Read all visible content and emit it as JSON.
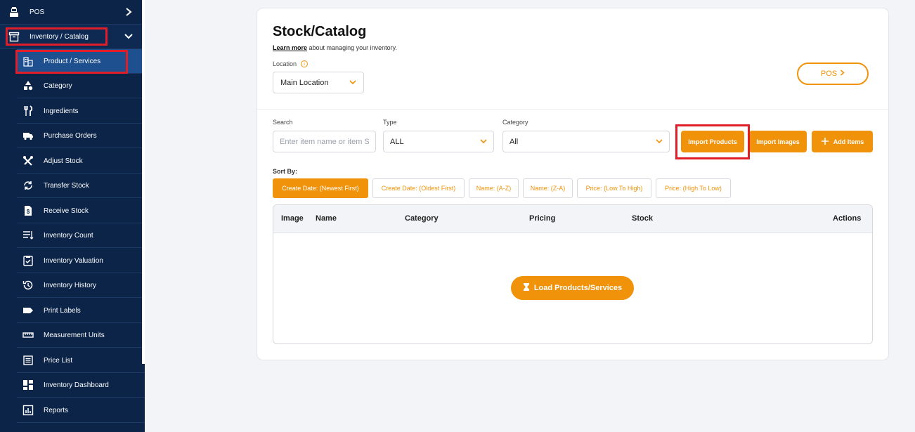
{
  "sidebar": {
    "pos": "POS",
    "inventory": "Inventory / Catalog",
    "items": [
      {
        "label": "Product / Services",
        "icon": "building-icon"
      },
      {
        "label": "Category",
        "icon": "shapes-icon"
      },
      {
        "label": "Ingredients",
        "icon": "utensils-icon"
      },
      {
        "label": "Purchase Orders",
        "icon": "truck-icon"
      },
      {
        "label": "Adjust Stock",
        "icon": "tools-icon"
      },
      {
        "label": "Transfer Stock",
        "icon": "sync-icon"
      },
      {
        "label": "Receive Stock",
        "icon": "receipt-icon"
      },
      {
        "label": "Inventory Count",
        "icon": "list-icon"
      },
      {
        "label": "Inventory Valuation",
        "icon": "clipboard-check-icon"
      },
      {
        "label": "Inventory History",
        "icon": "history-icon"
      },
      {
        "label": "Print Labels",
        "icon": "label-icon"
      },
      {
        "label": "Measurement Units",
        "icon": "ruler-icon"
      },
      {
        "label": "Price List",
        "icon": "price-list-icon"
      },
      {
        "label": "Inventory Dashboard",
        "icon": "dashboard-icon"
      },
      {
        "label": "Reports",
        "icon": "reports-icon"
      }
    ]
  },
  "header": {
    "title": "Stock/Catalog",
    "learn_more": "Learn more",
    "learn_rest": " about managing your inventory.",
    "location_label": "Location",
    "location_value": "Main Location",
    "pos_button": "POS"
  },
  "filters": {
    "search_label": "Search",
    "search_placeholder": "Enter item name or item SKU",
    "type_label": "Type",
    "type_value": "ALL",
    "category_label": "Category",
    "category_value": "All",
    "import_products": "Import Products",
    "import_images": "Import Images",
    "add_items": "Add Items"
  },
  "sort": {
    "label": "Sort By:",
    "options": [
      "Create Date: (Newest First)",
      "Create Date: (Oldest First)",
      "Name: (A-Z)",
      "Name: (Z-A)",
      "Price: (Low To High)",
      "Price: (High To Low)"
    ]
  },
  "table": {
    "columns": [
      "Image",
      "Name",
      "Category",
      "Pricing",
      "Stock",
      "Actions"
    ],
    "load_button": "Load Products/Services"
  },
  "colors": {
    "accent": "#f0930a",
    "sidebar": "#0b2447",
    "highlight": "#e01e2a"
  }
}
